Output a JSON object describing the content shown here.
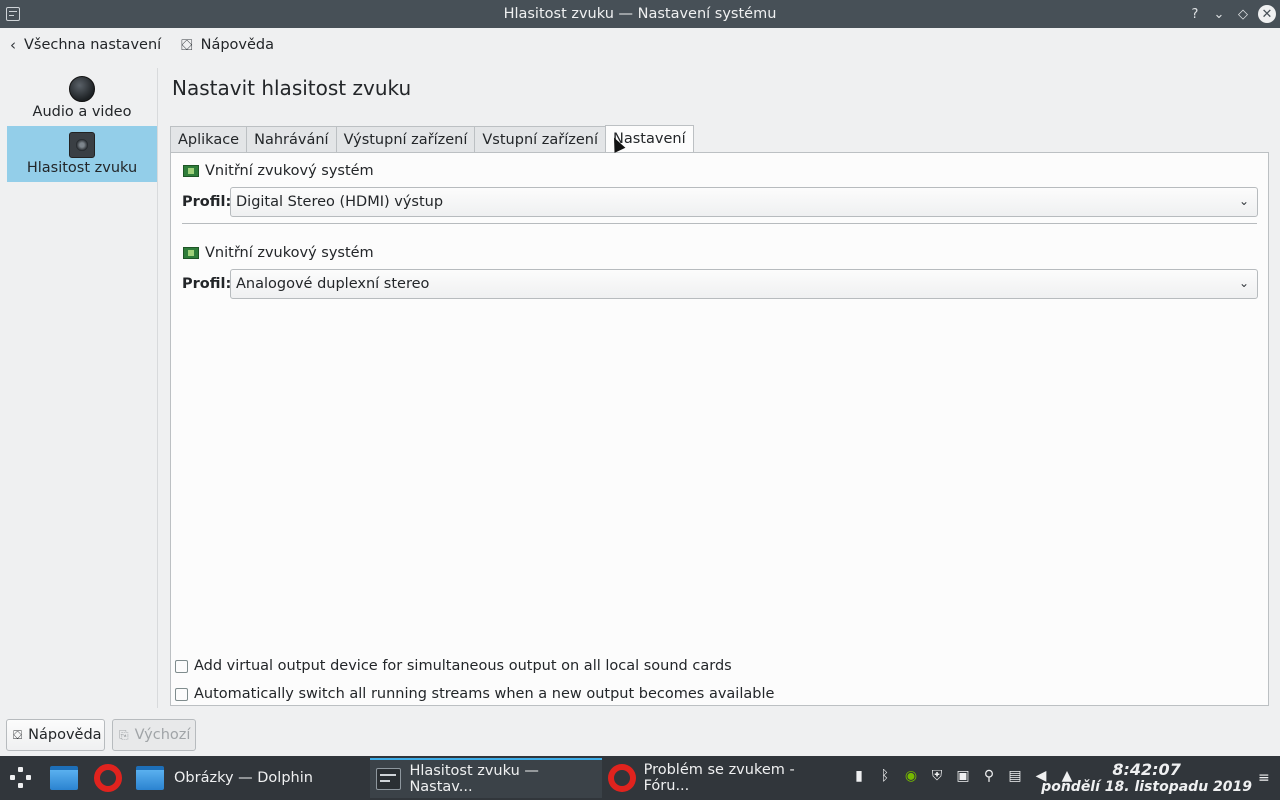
{
  "window": {
    "title": "Hlasitost zvuku — Nastavení systému",
    "buttons": [
      "?",
      "⌄",
      "◇",
      "✕"
    ]
  },
  "toolbar": {
    "back_label": "Všechna nastavení",
    "help_label": "Nápověda"
  },
  "sidebar": {
    "items": [
      {
        "label": "Audio a video",
        "icon": "audio-video-icon",
        "selected": false
      },
      {
        "label": "Hlasitost zvuku",
        "icon": "speaker-icon",
        "selected": true
      }
    ]
  },
  "main": {
    "title": "Nastavit hlasitost zvuku",
    "tabs": [
      {
        "label": "Aplikace",
        "active": false
      },
      {
        "label": "Nahrávání",
        "active": false
      },
      {
        "label": "Výstupní zařízení",
        "active": false
      },
      {
        "label": "Vstupní zařízení",
        "active": false
      },
      {
        "label": "Nastavení",
        "active": true
      }
    ],
    "cards": [
      {
        "name": "Vnitřní zvukový systém",
        "profile_label": "Profil:",
        "profile_value": "Digital Stereo (HDMI) výstup"
      },
      {
        "name": "Vnitřní zvukový systém",
        "profile_label": "Profil:",
        "profile_value": "Analogové duplexní stereo"
      }
    ],
    "checkboxes": [
      {
        "label": "Add virtual output device for simultaneous output on all local sound cards",
        "checked": false
      },
      {
        "label": "Automatically switch all running streams when a new output becomes available",
        "checked": false
      }
    ]
  },
  "footer": {
    "help_label": "Nápověda",
    "default_label": "Výchozí"
  },
  "taskbar": {
    "tasks": [
      {
        "label": "Obrázky — Dolphin",
        "icon": "folder-icon"
      },
      {
        "label": "Hlasitost zvuku  — Nastav...",
        "icon": "settings-icon",
        "active": true
      },
      {
        "label": "Problém se zvukem - Fóru...",
        "icon": "opera-icon"
      }
    ],
    "clock": {
      "time": "8:42:07",
      "date": "pondělí 18. listopadu 2019"
    }
  },
  "colors": {
    "selection": "#93cee9",
    "titlebar": "#475057",
    "taskbar": "#31363b",
    "accent": "#3daee9"
  }
}
